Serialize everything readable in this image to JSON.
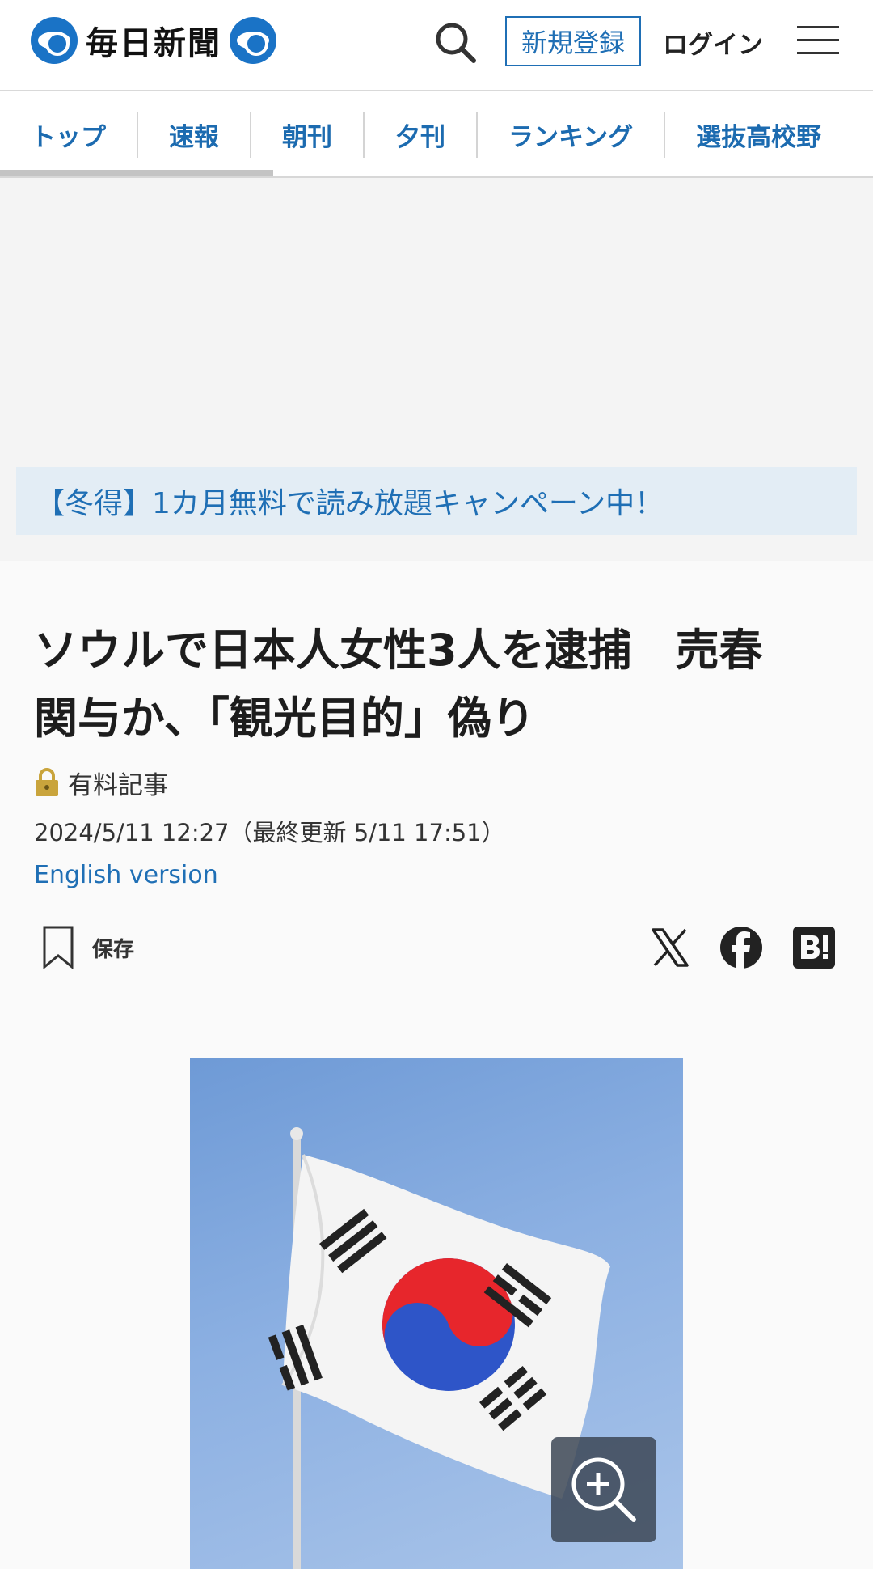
{
  "header": {
    "logo_text": "毎日新聞",
    "register_label": "新規登録",
    "login_label": "ログイン"
  },
  "nav": {
    "tabs": [
      "トップ",
      "速報",
      "朝刊",
      "夕刊",
      "ランキング",
      "選抜高校野"
    ]
  },
  "campaign": {
    "text": "【冬得】1カ月無料で読み放題キャンペーン中！"
  },
  "article": {
    "title_line1": "ソウルで日本人女性3人を逮捕　売春",
    "title_line2": "関与か、「観光目的」偽り",
    "paid_label": "有料記事",
    "date": "2024/5/11 12:27（最終更新 5/11 17:51）",
    "english_link": "English version",
    "save_label": "保存"
  },
  "colors": {
    "accent": "#1f6fb5",
    "brand": "#1a73c6"
  }
}
